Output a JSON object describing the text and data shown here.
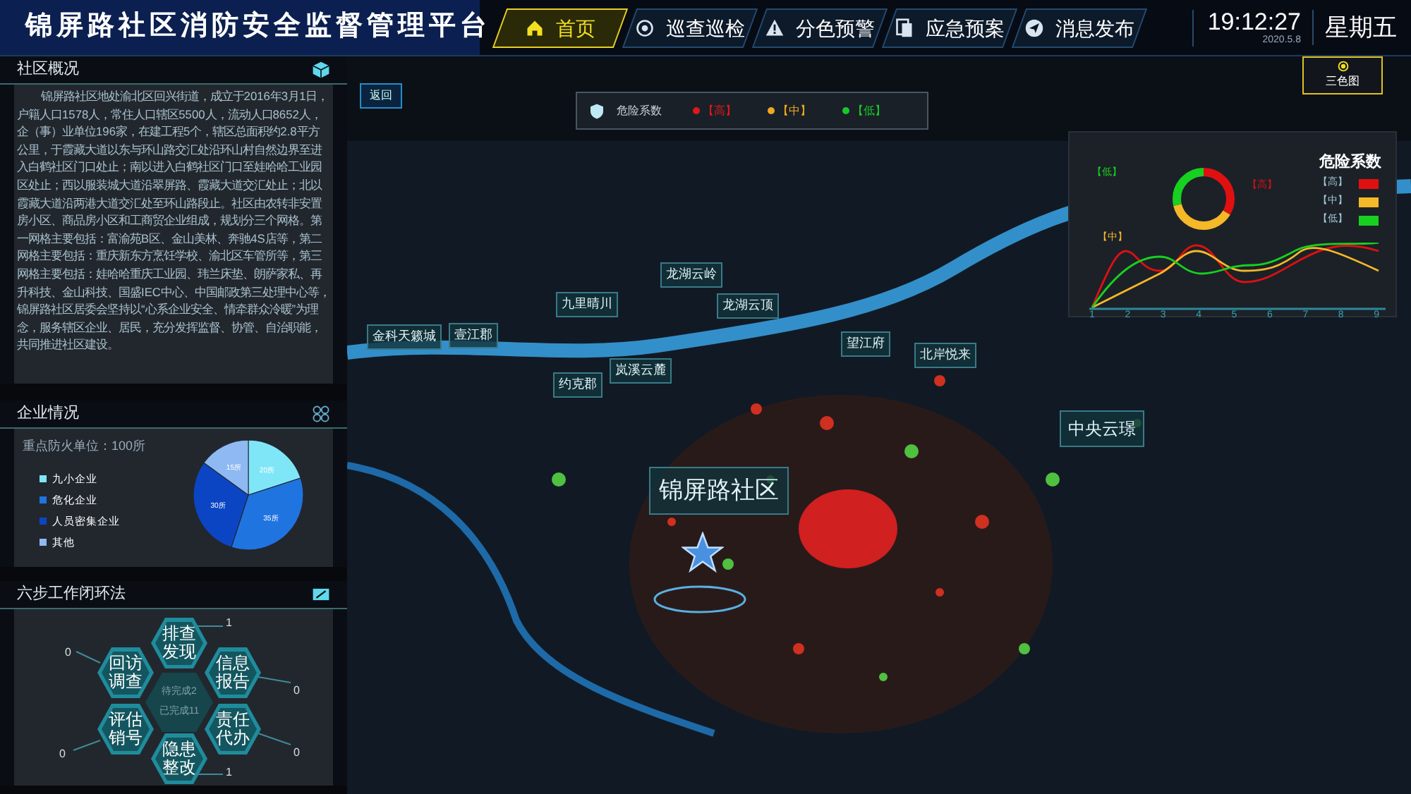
{
  "header": {
    "title": "锦屏路社区消防安全监督管理平台",
    "time": "19:12:27",
    "date": "2020.5.8",
    "weekday": "星期五"
  },
  "nav": [
    {
      "label": "首页",
      "selected": true
    },
    {
      "label": "巡查巡检",
      "selected": false
    },
    {
      "label": "分色预警",
      "selected": false
    },
    {
      "label": "应急预案",
      "selected": false
    },
    {
      "label": "消息发布",
      "selected": false
    }
  ],
  "overview": {
    "title": "社区概况",
    "text": "锦屏路社区地处渝北区回兴街道，成立于2016年3月1日，户籍人口1578人，常住人口辖区5500人，流动人口8652人，企（事）业单位196家，在建工程5个，辖区总面积约2.8平方公里，于霞藏大道以东与环山路交汇处沿环山村自然边界至进入白鹤社区门口处止；南以进入白鹤社区门口至娃哈哈工业园区处止；西以服装城大道沿翠屏路、霞藏大道交汇处止；北以霞藏大道沿两港大道交汇处至环山路段止。社区由农转非安置房小区、商品房小区和工商贸企业组成，规划分三个网格。第一网格主要包括：富渝苑B区、金山美林、奔驰4S店等，第二网格主要包括：重庆新东方烹饪学校、渝北区车管所等，第三网格主要包括：娃哈哈重庆工业园、玮兰床垫、朗萨家私、再升科技、金山科技、国盛IEC中心、中国邮政第三处理中心等，锦屏路社区居委会坚持以“心系企业安全、情牵群众冷暖”为理念，服务辖区企业、居民，充分发挥监督、协管、自治职能，共同推进社区建设。"
  },
  "enterprise": {
    "title": "企业情况",
    "summary": "重点防火单位：100所",
    "chart_data": {
      "type": "pie",
      "categories": [
        "九小企业",
        "危化企业",
        "人员密集企业",
        "其他"
      ],
      "series": [
        {
          "values": [
            20,
            35,
            30,
            15
          ]
        }
      ],
      "colors": [
        "#7fe6f7",
        "#1f74e0",
        "#0b45c4",
        "#8fb9f2"
      ],
      "value_labels": [
        "20所",
        "35所",
        "30所",
        "15所"
      ]
    }
  },
  "six_steps": {
    "title": "六步工作闭环法",
    "pending": "待完成2",
    "done": "已完成11",
    "steps": [
      {
        "label": "排查发现",
        "count": "1"
      },
      {
        "label": "回访调查",
        "count": "0"
      },
      {
        "label": "信息报告",
        "count": "0"
      },
      {
        "label": "评估销号",
        "count": "0"
      },
      {
        "label": "责任代办",
        "count": "0"
      },
      {
        "label": "隐患整改",
        "count": "1"
      }
    ]
  },
  "map": {
    "back": "返回",
    "legend_title": "危险系数",
    "legend": [
      {
        "label": "【高】",
        "color": "#e01818"
      },
      {
        "label": "【中】",
        "color": "#f0a820"
      },
      {
        "label": "【低】",
        "color": "#18c828"
      }
    ],
    "three_color_button": "三色图",
    "labels": [
      "金科天籁城",
      "壹江郡",
      "九里晴川",
      "龙湖云岭",
      "龙湖云顶",
      "约克郡",
      "岚溪云麓",
      "望江府",
      "北岸悦来",
      "中央云璟",
      "锦屏路社区"
    ]
  },
  "risk_panel": {
    "title": "危险系数",
    "legend": [
      {
        "label": "【高】",
        "color": "#e01010"
      },
      {
        "label": "【中】",
        "color": "#f4b828"
      },
      {
        "label": "【低】",
        "color": "#18d020"
      }
    ],
    "donut_labels": [
      {
        "label": "【低】",
        "color": "#18d020"
      },
      {
        "label": "【高】",
        "color": "#e01010"
      },
      {
        "label": "【中】",
        "color": "#f4b828"
      }
    ],
    "x_ticks": [
      "1",
      "2",
      "3",
      "4",
      "5",
      "6",
      "7",
      "8",
      "9"
    ]
  }
}
